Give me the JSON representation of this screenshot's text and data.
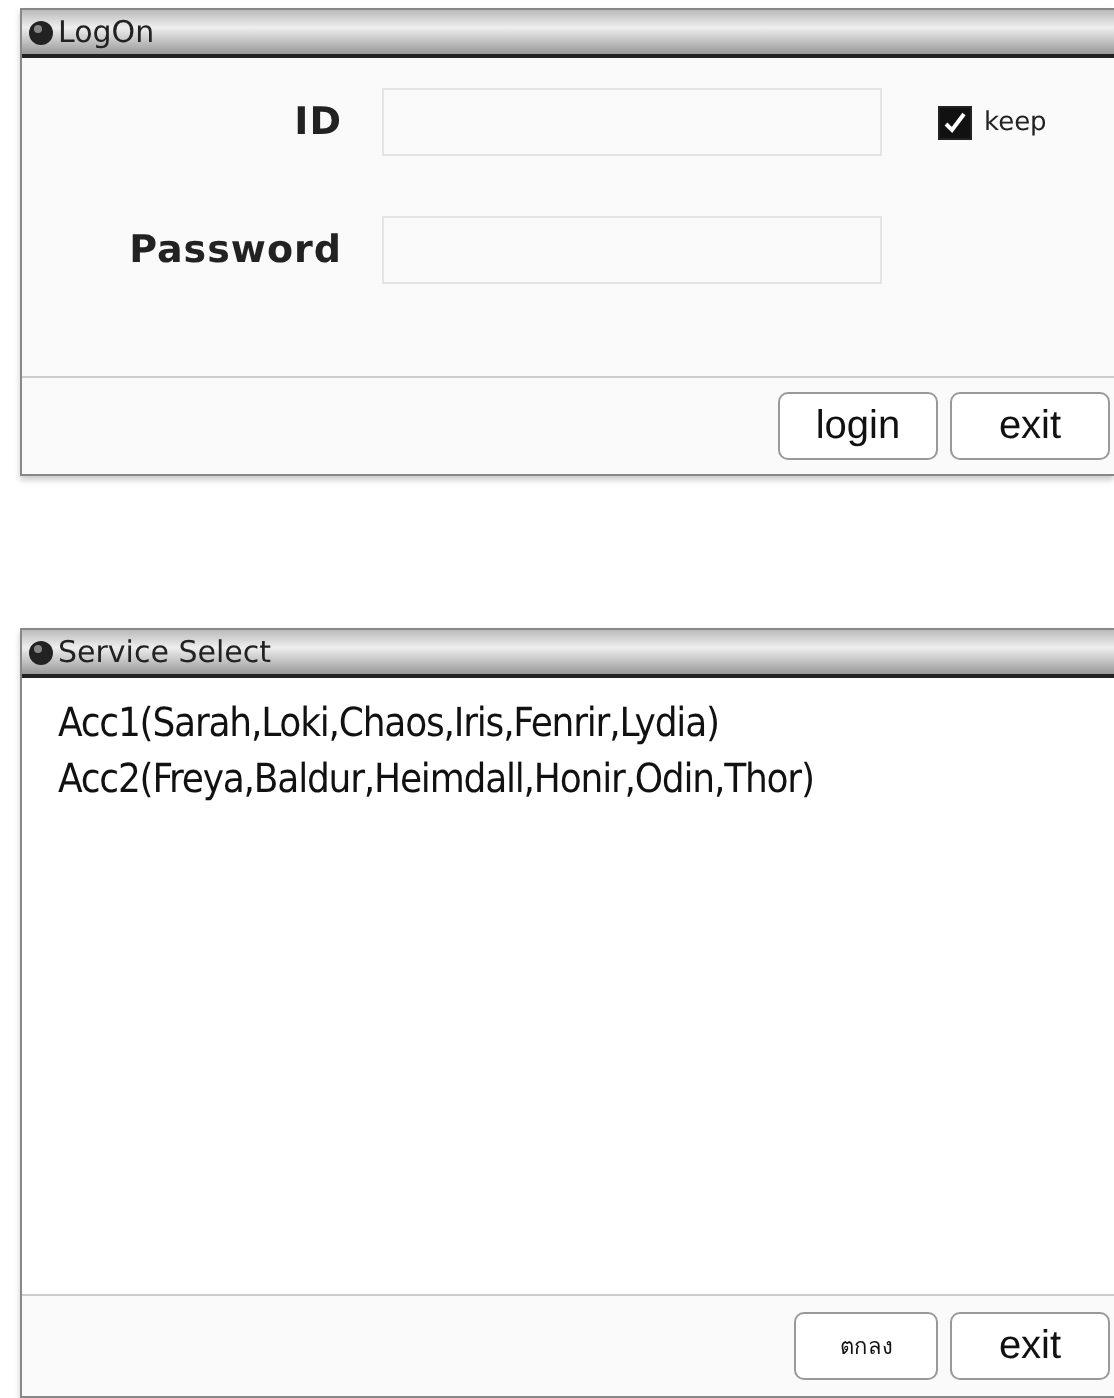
{
  "logon_window": {
    "title": "LogOn",
    "fields": [
      {
        "label": "ID"
      },
      {
        "label": "Password"
      }
    ],
    "keep": {
      "label": "keep",
      "checked": true
    },
    "buttons": [
      "login",
      "exit"
    ]
  },
  "service_window": {
    "title": "Service Select",
    "items": [
      "Acc1(Sarah,Loki,Chaos,Iris,Fenrir,Lydia)",
      "Acc2(Freya,Baldur,Heimdall,Honir,Odin,Thor)"
    ],
    "buttons": [
      {
        "label": "ตกลง",
        "kind": "small"
      },
      {
        "label": "exit",
        "kind": "normal"
      }
    ]
  }
}
